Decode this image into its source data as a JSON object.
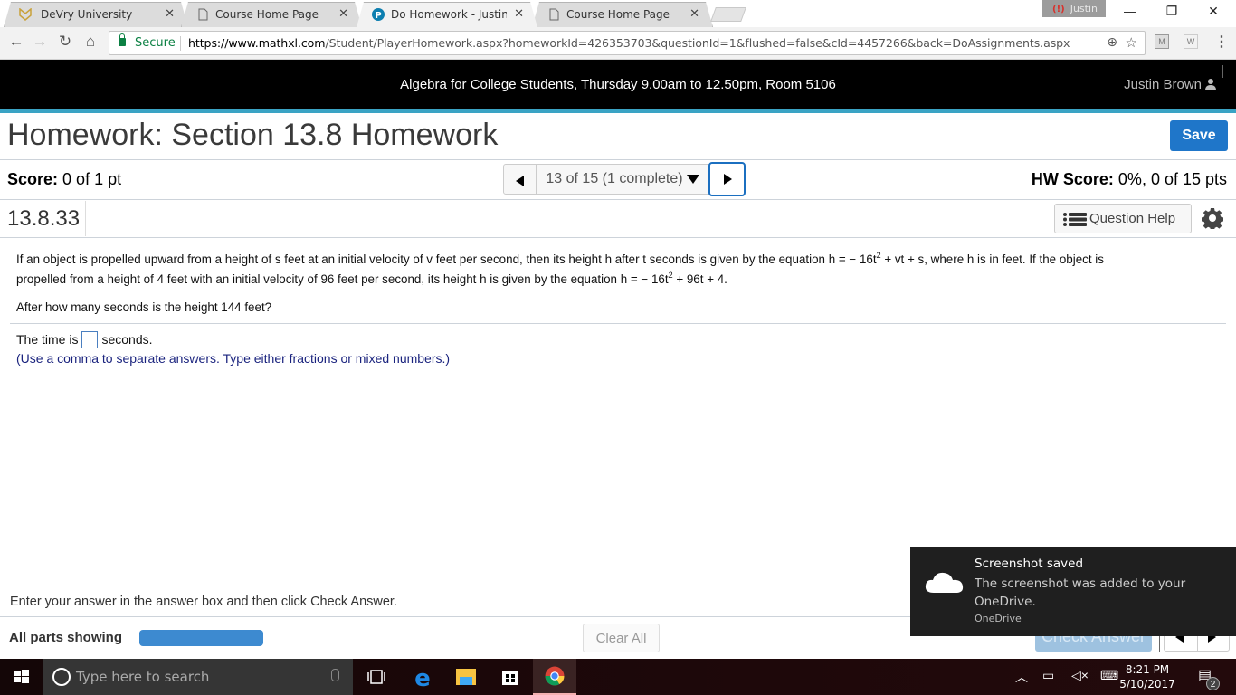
{
  "browser": {
    "tabs": [
      {
        "label": "DeVry University",
        "icon": "devry-logo-icon",
        "active": false
      },
      {
        "label": "Course Home Page",
        "icon": "page-icon",
        "active": false
      },
      {
        "label": "Do Homework - Justin Br",
        "icon": "pearson-icon",
        "active": true
      },
      {
        "label": "Course Home Page",
        "icon": "page-icon",
        "active": false
      }
    ],
    "close_glyph": "✕",
    "profile_name": "Justin",
    "window_controls": {
      "minimize": "—",
      "restore": "❐",
      "close": "✕"
    },
    "secure_label": "Secure",
    "url_host": "https://www.mathxl.com",
    "url_path": "/Student/PlayerHomework.aspx?homeworkId=426353703&questionId=1&flushed=false&cId=4457266&back=DoAssignments.aspx",
    "extensions": [
      "M",
      "W"
    ]
  },
  "header": {
    "course_title": "Algebra for College Students, Thursday 9.00am to 12.50pm, Room 5106",
    "user_name": "Justin Brown"
  },
  "homework": {
    "title": "Homework: Section 13.8 Homework",
    "save_label": "Save",
    "score_label": "Score:",
    "score_value": "0 of 1 pt",
    "question_nav": "13 of 15 (1 complete)",
    "hw_score_label": "HW Score:",
    "hw_score_value": "0%, 0 of 15 pts",
    "question_id": "13.8.33",
    "question_help_label": "Question Help"
  },
  "question": {
    "para1_a": "If an object is propelled upward from a height of s feet at an initial velocity of v feet per second, then its height h after t seconds is given by the equation h = − 16t",
    "para1_sup": "2",
    "para1_b": " + vt + s, where h is in feet. If the object is",
    "para2_a": "propelled from a height of 4 feet with an initial velocity of 96 feet per second, its height h is given by the equation h = − 16t",
    "para2_sup": "2",
    "para2_b": " + 96t + 4.",
    "prompt": "After how many seconds is the height 144 feet?",
    "answer_prefix": "The time is",
    "answer_value": "",
    "answer_suffix": "seconds.",
    "hint": "(Use a comma to separate answers. Type either fractions or mixed numbers.)"
  },
  "footer": {
    "instruction": "Enter your answer in the answer box and then click Check Answer.",
    "all_parts_label": "All parts showing",
    "parts_progress": 1.0,
    "clear_all_label": "Clear All",
    "check_answer_label": "Check Answer"
  },
  "toast": {
    "title": "Screenshot saved",
    "body": "The screenshot was added to your OneDrive.",
    "app": "OneDrive"
  },
  "taskbar": {
    "search_placeholder": "Type here to search",
    "apps": [
      "task-view",
      "edge",
      "file-explorer",
      "store",
      "chrome"
    ],
    "time": "8:21 PM",
    "date": "5/10/2017",
    "notification_count": "2"
  },
  "colors": {
    "accent_bar": "#3aa3c4",
    "save_button": "#1f76c9",
    "secure_green": "#0b8043",
    "hint_text": "#1a237e"
  }
}
